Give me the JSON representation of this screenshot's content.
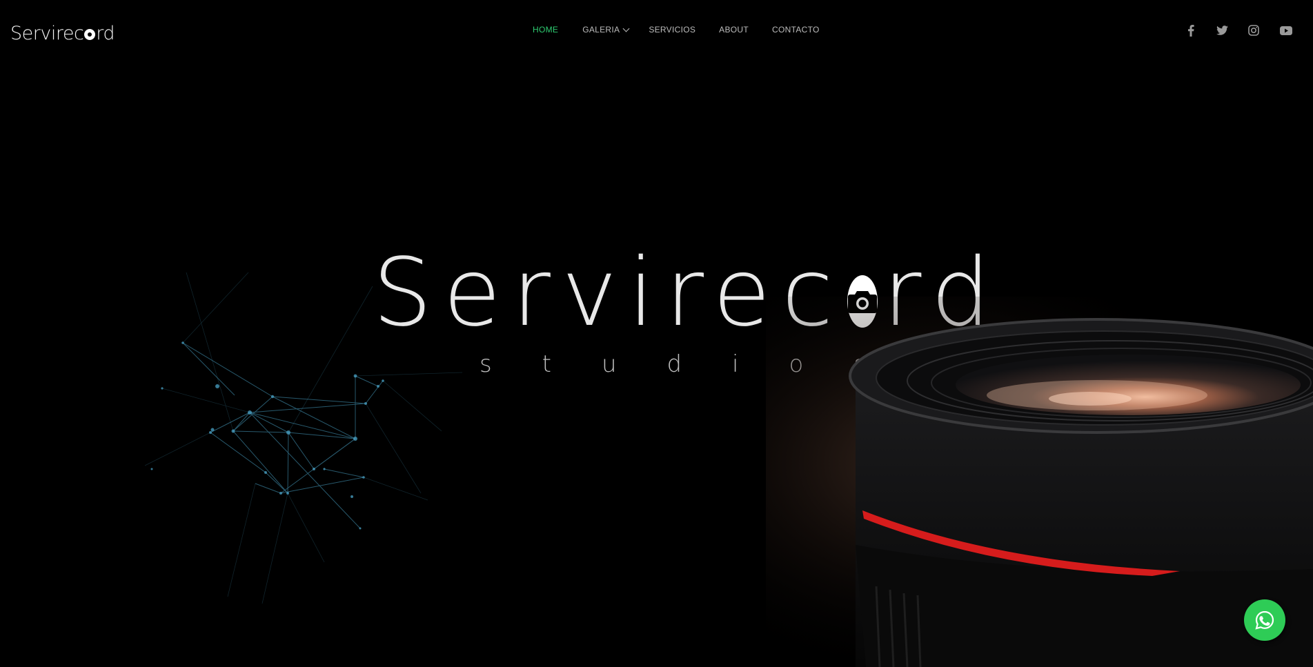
{
  "header": {
    "logo": {
      "prefix": "Servirec",
      "suffix": "rd"
    },
    "nav": [
      {
        "label": "HOME",
        "active": true
      },
      {
        "label": "GALERIA",
        "dropdown": true
      },
      {
        "label": "SERVICIOS"
      },
      {
        "label": "ABOUT"
      },
      {
        "label": "CONTACTO"
      }
    ],
    "social_icons": [
      "facebook-icon",
      "twitter-icon",
      "instagram-icon",
      "youtube-icon"
    ]
  },
  "hero": {
    "title_prefix": "Servirec",
    "title_suffix": "rd",
    "subtitle_letters": [
      "s",
      "t",
      "u",
      "d",
      "i",
      "o",
      "s"
    ]
  },
  "whatsapp": {
    "icon": "whatsapp-icon"
  },
  "colors": {
    "background": "#000000",
    "accent": "#2ecc71",
    "whatsapp": "#2ecc56",
    "lens_ring": "#d61c1c",
    "network": "#4aa3c7"
  }
}
